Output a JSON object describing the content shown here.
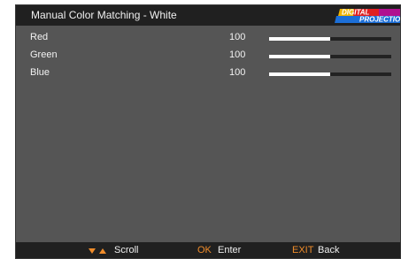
{
  "header": {
    "title": "Manual Color Matching - White",
    "logo": {
      "line1": "DIGITAL",
      "line2": "PROJECTION",
      "icon": "digital-projection-logo"
    }
  },
  "rows": [
    {
      "label": "Red",
      "value": "100",
      "level": 0.5
    },
    {
      "label": "Green",
      "value": "100",
      "level": 0.5
    },
    {
      "label": "Blue",
      "value": "100",
      "level": 0.5
    }
  ],
  "footer": {
    "scroll_icon": "up-down-arrows-icon",
    "scroll_label": "Scroll",
    "ok_key": "OK",
    "ok_label": "Enter",
    "exit_key": "EXIT",
    "exit_label": "Back"
  },
  "colors": {
    "background": "#555555",
    "bars": "#202020",
    "accent": "#f08c2a",
    "text": "#f2f2f2",
    "slider_fill": "#ffffff",
    "slider_track": "#222222"
  }
}
